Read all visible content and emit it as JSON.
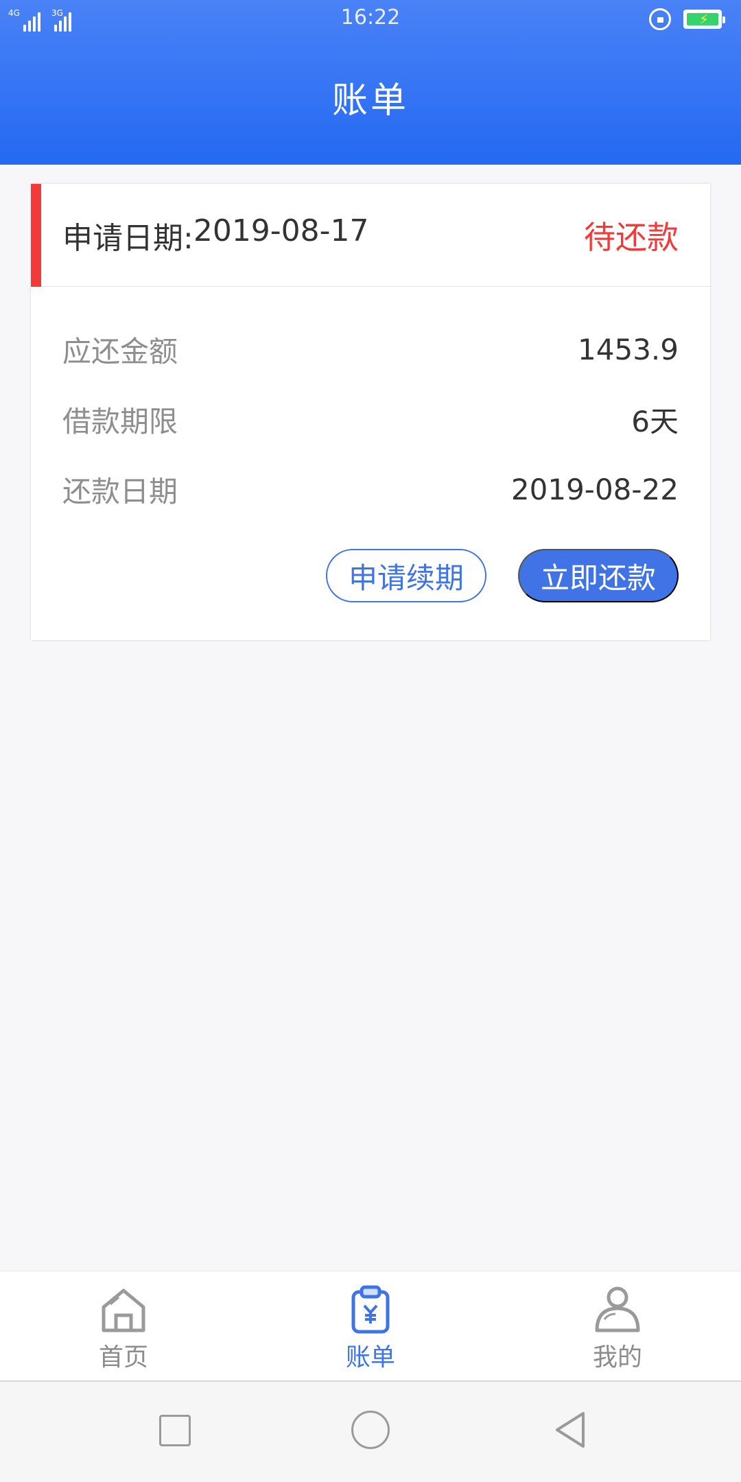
{
  "status_bar": {
    "time": "16:22",
    "net1": "4G",
    "net2": "3G",
    "icons": [
      "signal-4g-icon",
      "signal-3g-icon",
      "rotation-lock-icon",
      "battery-charging-icon"
    ]
  },
  "header": {
    "title": "账单"
  },
  "bill": {
    "apply_date_label": "申请日期:",
    "apply_date": "2019-08-17",
    "status": "待还款",
    "rows": [
      {
        "label": "应还金额",
        "value": "1453.9"
      },
      {
        "label": "借款期限",
        "value": "6天"
      },
      {
        "label": "还款日期",
        "value": "2019-08-22"
      }
    ],
    "renew_button": "申请续期",
    "repay_button": "立即还款"
  },
  "tabbar": {
    "items": [
      {
        "label": "首页",
        "icon": "home-icon",
        "active": false
      },
      {
        "label": "账单",
        "icon": "bill-icon",
        "active": true
      },
      {
        "label": "我的",
        "icon": "profile-icon",
        "active": false
      }
    ]
  },
  "navbar": {
    "icons": [
      "recent-apps-icon",
      "home-circle-icon",
      "back-icon"
    ]
  },
  "colors": {
    "header_blue": "#2469f2",
    "accent_red": "#f33a3a",
    "primary_blue": "#3f73e6",
    "inactive_gray": "#8c8c8c"
  }
}
